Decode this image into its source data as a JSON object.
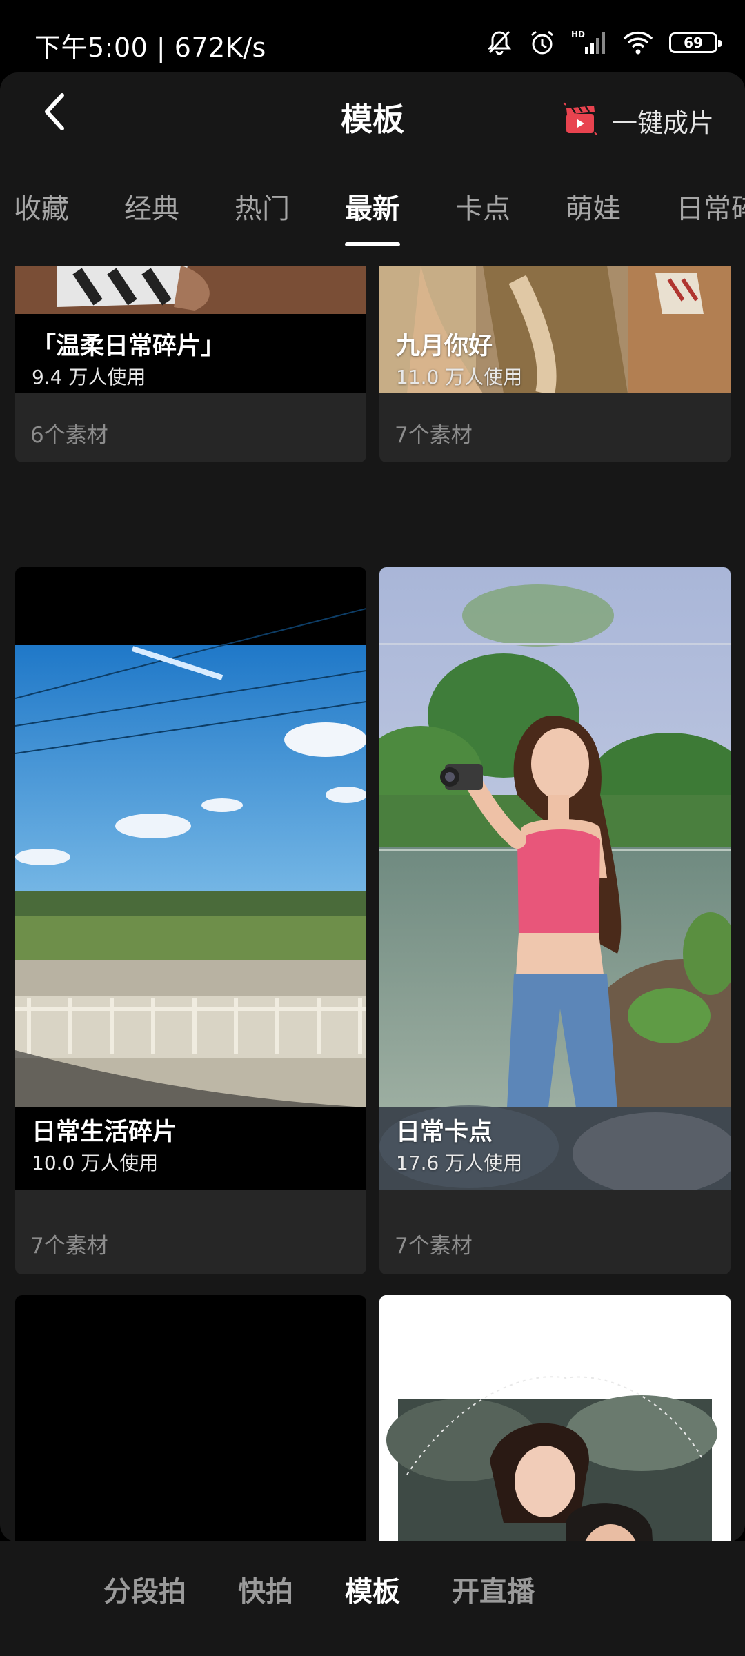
{
  "status_bar": {
    "time": "下午5:00 | 672K/s",
    "battery": "69",
    "icons": [
      "mute-bell-icon",
      "alarm-icon",
      "hd-signal-icon",
      "wifi-icon",
      "battery-icon"
    ]
  },
  "header": {
    "title": "模板",
    "back_icon": "chevron-left-icon",
    "one_click_label": "一键成片",
    "one_click_icon": "clapperboard-icon"
  },
  "tabs": [
    {
      "label": "收藏",
      "active": false
    },
    {
      "label": "经典",
      "active": false
    },
    {
      "label": "热门",
      "active": false
    },
    {
      "label": "最新",
      "active": true
    },
    {
      "label": "卡点",
      "active": false
    },
    {
      "label": "萌娃",
      "active": false
    },
    {
      "label": "日常碎",
      "active": false
    }
  ],
  "templates": [
    {
      "name": "「温柔日常碎片」",
      "usage": "9.4 万人使用",
      "materials": "6个素材"
    },
    {
      "name": "九月你好",
      "usage": "11.0 万人使用",
      "materials": "7个素材"
    },
    {
      "name": "日常生活碎片",
      "usage": "10.0 万人使用",
      "materials": "7个素材"
    },
    {
      "name": "日常卡点",
      "usage": "17.6 万人使用",
      "materials": "7个素材"
    }
  ],
  "bottom_nav": [
    {
      "label": "分段拍",
      "active": false
    },
    {
      "label": "快拍",
      "active": false
    },
    {
      "label": "模板",
      "active": true
    },
    {
      "label": "开直播",
      "active": false
    }
  ],
  "colors": {
    "background": "#000000",
    "sheet": "#171717",
    "card": "#262626",
    "accent_red": "#e8434f",
    "muted_text": "#8c8c8c"
  }
}
